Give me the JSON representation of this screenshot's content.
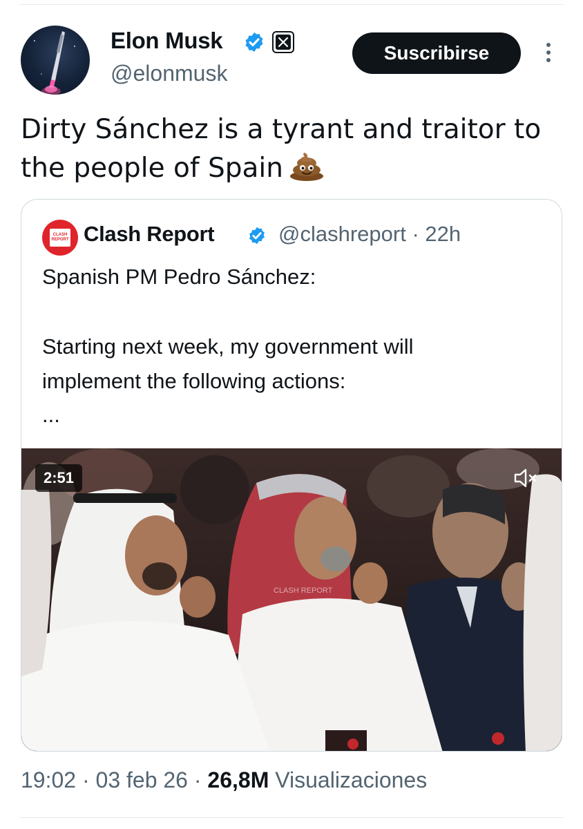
{
  "author": {
    "name": "Elon Musk",
    "handle": "@elonmusk",
    "avatar_icon": "rocket-launch-avatar",
    "verified_color": "#1d9bf0"
  },
  "actions": {
    "subscribe_label": "Suscribirse",
    "more_icon": "more-vertical-icon"
  },
  "tweet": {
    "line1": "Dirty Sánchez is a tyrant and traitor to",
    "line2": "the people of Spain",
    "emoji_icon": "pile-of-poo-icon"
  },
  "quote": {
    "name": "Clash Report",
    "handle": "@clashreport",
    "separator": "·",
    "age": "22h",
    "avatar_logo_text": "CLASH REPORT",
    "line1": "Spanish PM Pedro Sánchez:",
    "line2": "Starting next week, my government will",
    "line3": "implement the following actions:",
    "ellipsis": "...",
    "video": {
      "duration": "2:51",
      "watermark": "CLASH REPORT",
      "mute_icon": "speaker-muted-icon"
    }
  },
  "meta": {
    "time": "19:02",
    "dot1": "·",
    "date": "03 feb 26",
    "dot2": "·",
    "views_count": "26,8M",
    "views_label": "Visualizaciones"
  }
}
